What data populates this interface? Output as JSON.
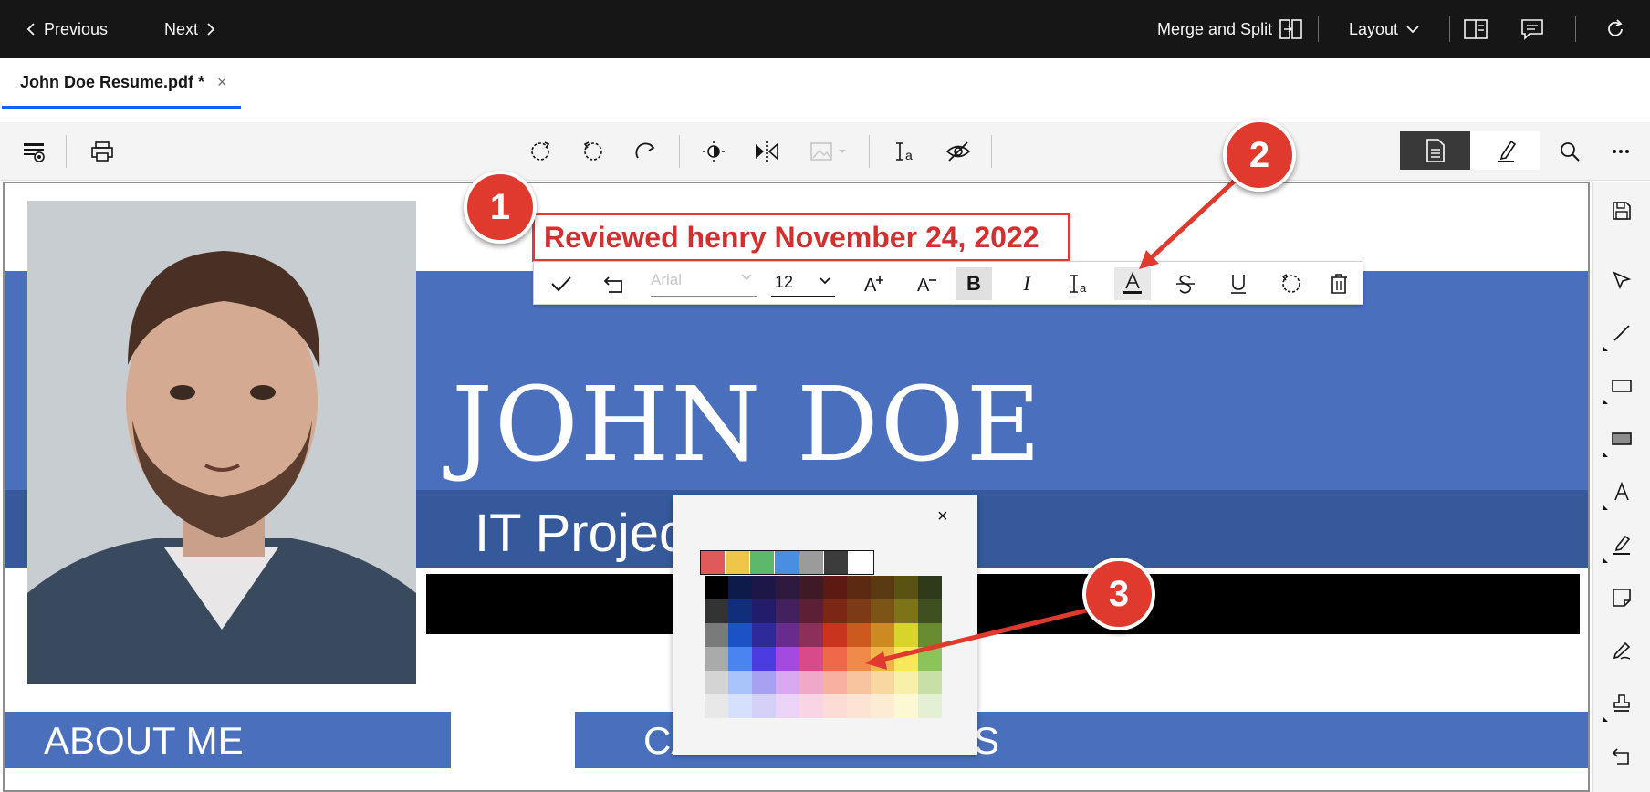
{
  "topbar": {
    "previous": "Previous",
    "next": "Next",
    "merge_split": "Merge and Split",
    "layout": "Layout"
  },
  "tab": {
    "title": "John Doe Resume.pdf *",
    "close": "×"
  },
  "document": {
    "stamp_text": "Reviewed henry November 24, 2022",
    "name": "JOHN DOE",
    "subtitle": "IT Projec",
    "about": "ABOUT ME",
    "career": "CA",
    "career_tail": "S"
  },
  "text_toolbar": {
    "font": "Arial",
    "size": "12",
    "bold": "B",
    "italic": "I"
  },
  "color_picker": {
    "close": "×",
    "recent": [
      "#e05a5a",
      "#f0c64a",
      "#5cb86a",
      "#4a8ee0",
      "#9b9b9b",
      "#3c3c3c",
      "#ffffff"
    ],
    "grid": [
      [
        "#000000",
        "#0d1b4a",
        "#1c1746",
        "#2e1a3e",
        "#3d1a26",
        "#5c1a12",
        "#5c2a12",
        "#5a3a12",
        "#5a5212",
        "#2e3a1a"
      ],
      [
        "#333333",
        "#102e7a",
        "#231c6a",
        "#43215e",
        "#5c1f36",
        "#7c2616",
        "#7c3a16",
        "#7c5416",
        "#7c7416",
        "#3e5020"
      ],
      [
        "#7a7a7a",
        "#1c52c8",
        "#2f2a9a",
        "#6a2c8c",
        "#8c2f5a",
        "#c8341e",
        "#cc5a1e",
        "#cc8a20",
        "#d8d42a",
        "#6a8c30"
      ],
      [
        "#aaaaaa",
        "#4a84f0",
        "#4a3ce0",
        "#a44ae0",
        "#d84a8a",
        "#f0684a",
        "#f08a4a",
        "#f0b44a",
        "#f8e85a",
        "#8cc45a"
      ],
      [
        "#d4d4d4",
        "#a8c4f8",
        "#a8a0f0",
        "#d8a8f0",
        "#f0a8c8",
        "#f8b0a0",
        "#f8c4a0",
        "#f8d8a0",
        "#f8f0a8",
        "#c8e0a8"
      ],
      [
        "#e8e8e8",
        "#d4e0fc",
        "#d4d0f8",
        "#ecd4f8",
        "#f8d4e4",
        "#fcdcd4",
        "#fce4d4",
        "#fcecd4",
        "#fcf8d4",
        "#e4f0d4"
      ]
    ]
  },
  "annotations": {
    "one": "1",
    "two": "2",
    "three": "3"
  },
  "colors": {
    "accent": "#0f62fe",
    "banner": "#4a70bd",
    "callout": "#e03a2e"
  }
}
